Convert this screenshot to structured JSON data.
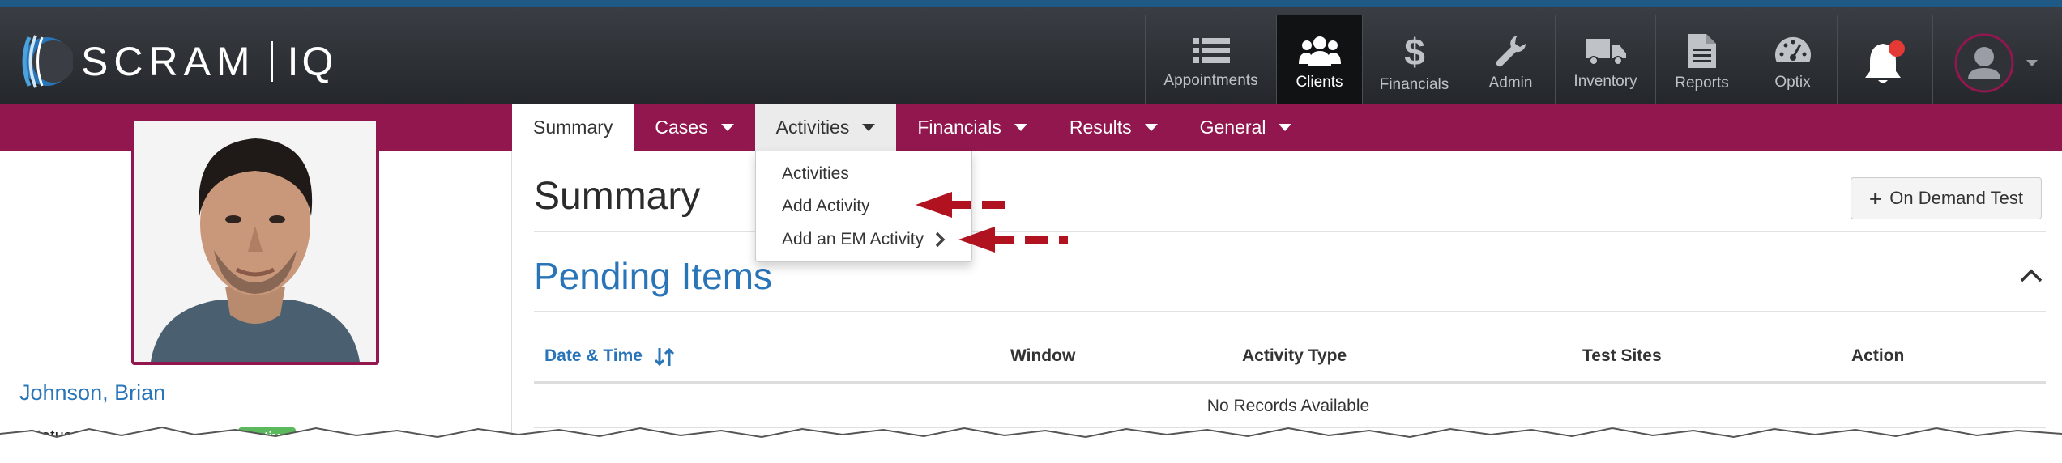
{
  "brand": {
    "word": "SCRAM",
    "suffix": "IQ"
  },
  "topnav": [
    {
      "label": "Appointments",
      "icon": "list-icon"
    },
    {
      "label": "Clients",
      "icon": "users-icon",
      "active": true
    },
    {
      "label": "Financials",
      "icon": "dollar-icon"
    },
    {
      "label": "Admin",
      "icon": "wrench-icon"
    },
    {
      "label": "Inventory",
      "icon": "truck-icon"
    },
    {
      "label": "Reports",
      "icon": "document-icon"
    },
    {
      "label": "Optix",
      "icon": "gauge-icon"
    }
  ],
  "tabs": {
    "summary": "Summary",
    "cases": "Cases",
    "activities": "Activities",
    "financials": "Financials",
    "results": "Results",
    "general": "General"
  },
  "dropdown": {
    "items": [
      "Activities",
      "Add Activity",
      "Add an EM Activity"
    ]
  },
  "client": {
    "name": "Johnson, Brian",
    "status_label": "Status",
    "status_value": "Active"
  },
  "main": {
    "title": "Summary",
    "on_demand_button": "On Demand Test",
    "pending_title": "Pending Items",
    "table": {
      "headers": [
        "Date & Time",
        "Window",
        "Activity Type",
        "Test Sites",
        "Action"
      ],
      "empty_text": "No Records Available"
    }
  },
  "colors": {
    "accent_magenta": "#92174f",
    "link_blue": "#2a74b8",
    "topbar_dark": "#2b2e33",
    "annotation_red": "#b0121f",
    "status_green": "#5cb85c",
    "notification_red": "#e53935"
  }
}
